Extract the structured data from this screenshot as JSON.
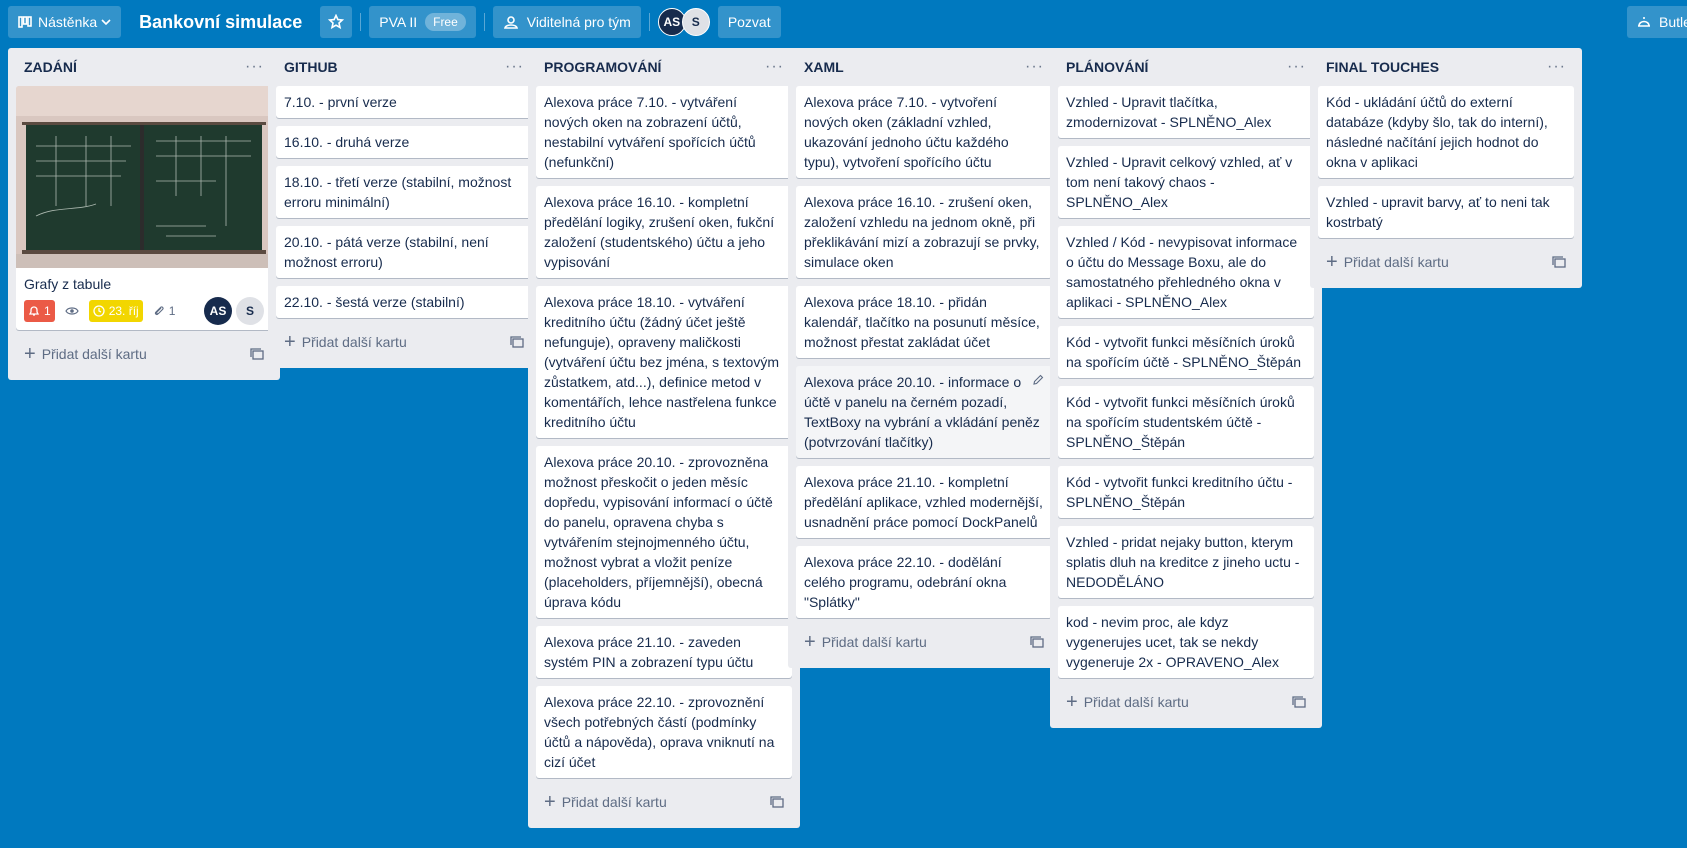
{
  "header": {
    "boards_label": "Nástěnka",
    "board_title": "Bankovní simulace",
    "workspace": "PVA II",
    "plan_badge": "Free",
    "visibility": "Viditelná pro tým",
    "members": [
      "AS",
      "S"
    ],
    "invite": "Pozvat",
    "butler": "Butle"
  },
  "add_card_label": "Přidat další kartu",
  "lists": [
    {
      "title": "ZADÁNÍ",
      "cover_card": {
        "title": "Grafy z tabule",
        "notifications": "1",
        "due": "23. říj",
        "attachments": "1",
        "members": [
          "AS",
          "S"
        ]
      },
      "cards": []
    },
    {
      "title": "GITHUB",
      "cards": [
        "7.10. - první verze",
        "16.10. - druhá verze",
        "18.10. - třetí verze (stabilní, možnost erroru minimální)",
        "20.10. - pátá verze (stabilní, není možnost erroru)",
        "22.10. - šestá verze (stabilní)"
      ]
    },
    {
      "title": "PROGRAMOVÁNÍ",
      "cards": [
        "Alexova práce 7.10. - vytváření nových oken na zobrazení účtů, nestabilní vytváření spořících účtů (nefunkční)",
        "Alexova práce 16.10. - kompletní předělání logiky, zrušení oken, fukční založení (studentského) účtu a jeho vypisování",
        "Alexova práce 18.10. - vytváření kreditního účtu (žádný účet ještě nefunguje), opraveny maličkosti (vytváření účtu bez jména, s textovým zůstatkem, atd...), definice metod v komentářích, lehce nastřelena funkce kreditního účtu",
        "Alexova práce 20.10. - zprovozněna možnost přeskočit o jeden měsíc dopředu, vypisování informací o účtě do panelu, opravena chyba s vytvářením stejnojmenného účtu, možnost vybrat a vložit peníze (placeholders, příjemnější), obecná úprava kódu",
        "Alexova práce 21.10. - zaveden systém PIN a zobrazení typu účtu",
        "Alexova práce 22.10. - zprovoznění všech potřebných částí (podmínky účtů a nápověda), oprava vniknutí na cizí účet"
      ]
    },
    {
      "title": "XAML",
      "cards": [
        "Alexova práce 7.10. - vytvoření nových oken (základní vzhled, ukazování jednoho účtu každého typu), vytvoření spořícího účtu",
        "Alexova práce 16.10. - zrušení oken, založení vzhledu na jednom okně, při překlikávání mizí a zobrazují se prvky, simulace oken",
        "Alexova práce 18.10. - přidán kalendář, tlačítko na posunutí měsíce, možnost přestat zakládat účet",
        "Alexova práce 20.10. - informace o účtě v panelu na černém pozadí, TextBoxy na vybrání a vkládání peněz (potvrzování tlačítky)",
        "Alexova práce 21.10. - kompletní předělání aplikace, vzhled modernější, usnadnění práce pomocí DockPanelů",
        "Alexova práce 22.10. - dodělání celého programu, odebrání okna \"Splátky\""
      ]
    },
    {
      "title": "PLÁNOVÁNÍ",
      "cards": [
        "Vzhled - Upravit tlačítka, zmodernizovat - SPLNĚNO_Alex",
        "Vzhled - Upravit celkový vzhled, ať v tom není takový chaos - SPLNĚNO_Alex",
        "Vzhled / Kód - nevypisovat informace o účtu do Message Boxu, ale do samostatného přehledného okna v aplikaci - SPLNĚNO_Alex",
        "Kód - vytvořit funkci měsíčních úroků na spořícím účtě - SPLNĚNO_Štěpán",
        "Kód - vytvořit funkci měsíčních úroků na spořícím studentském účtě - SPLNĚNO_Štěpán",
        "Kód - vytvořit funkci kreditního účtu - SPLNĚNO_Štěpán",
        "Vzhled - pridat nejaky button, kterym splatis dluh na kreditce z jineho uctu - NEDODĚLÁNO",
        "kod - nevim proc, ale kdyz vygenerujes ucet, tak se nekdy vygeneruje 2x - OPRAVENO_Alex"
      ]
    },
    {
      "title": "FINAL TOUCHES",
      "cards": [
        "Kód - ukládání účtů do externí databáze (kdyby šlo, tak do interní), následné načítání jejich hodnot do okna v aplikaci",
        "Vzhled - upravit barvy, ať to neni tak kostrbatý"
      ]
    }
  ]
}
